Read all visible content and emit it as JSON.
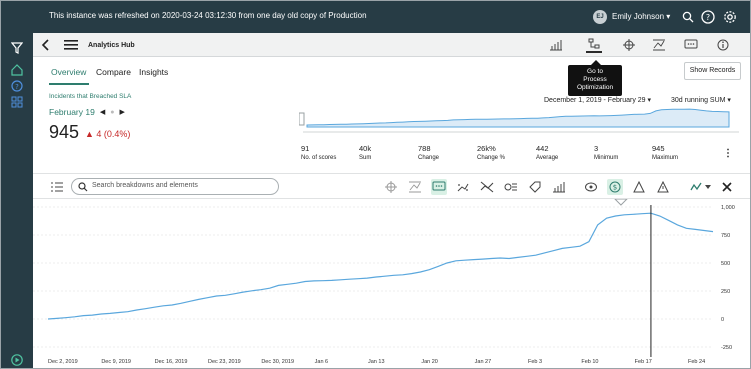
{
  "banner": {
    "notice": "This instance was refreshed on 2020-03-24 03:12:30 from one day old copy of Production"
  },
  "user": {
    "initials": "EJ",
    "name": "Emily Johnson ▾"
  },
  "header": {
    "title": "Analytics Hub"
  },
  "tooltip": {
    "line1": "Go to",
    "line2": "Process",
    "line3": "Optimization"
  },
  "tabs": [
    "Overview",
    "Compare",
    "Insights"
  ],
  "buttons": {
    "show_records": "Show Records"
  },
  "metric": {
    "title": "Incidents that Breached SLA",
    "date": "February 19",
    "value": "945",
    "delta": "▲ 4 (0.4%)",
    "date_range": "December 1, 2019 - February 29  ▾",
    "aggregation": "30d running SUM  ▾"
  },
  "stats": [
    {
      "value": "91",
      "label": "No. of scores"
    },
    {
      "value": "40k",
      "label": "Sum"
    },
    {
      "value": "788",
      "label": "Change"
    },
    {
      "value": "26k%",
      "label": "Change %"
    },
    {
      "value": "442",
      "label": "Average"
    },
    {
      "value": "3",
      "label": "Minimum"
    },
    {
      "value": "945",
      "label": "Maximum"
    }
  ],
  "search": {
    "placeholder": "Search breakdowns and elements"
  },
  "colors": {
    "topbar": "#273c45",
    "accent": "#2e7d6e",
    "line": "#5aa7dd",
    "delta": "#c62828"
  },
  "chart_data": {
    "type": "line",
    "x": [
      "Dec 2, 2019",
      "Dec 9, 2019",
      "Dec 16, 2019",
      "Dec 23, 2019",
      "Dec 30, 2019",
      "Jan 6",
      "Jan 13",
      "Jan 20",
      "Jan 27",
      "Feb 3",
      "Feb 10",
      "Feb 17",
      "Feb 24"
    ],
    "y_ticks": [
      "1,000",
      "750",
      "500",
      "250",
      "0",
      "-250"
    ],
    "ylim": [
      -250,
      1000
    ],
    "series": [
      {
        "values": [
          0,
          5,
          12,
          20,
          30,
          35,
          45,
          50,
          58,
          65,
          80,
          92,
          105,
          118,
          125,
          140,
          158,
          175,
          190,
          205,
          212,
          225,
          240,
          252,
          262,
          275,
          300,
          310,
          320,
          335,
          340,
          342,
          345,
          350,
          355,
          360,
          365,
          375,
          382,
          390,
          395,
          405,
          420,
          440,
          470,
          500,
          520,
          525,
          530,
          535,
          540,
          545,
          540,
          550,
          560,
          570,
          590,
          610,
          630,
          640,
          650,
          690,
          840,
          900,
          920,
          930,
          935,
          940,
          945,
          920,
          880,
          840,
          810,
          800,
          790,
          780
        ]
      }
    ],
    "grid": true,
    "marker_date": "Feb 19"
  }
}
